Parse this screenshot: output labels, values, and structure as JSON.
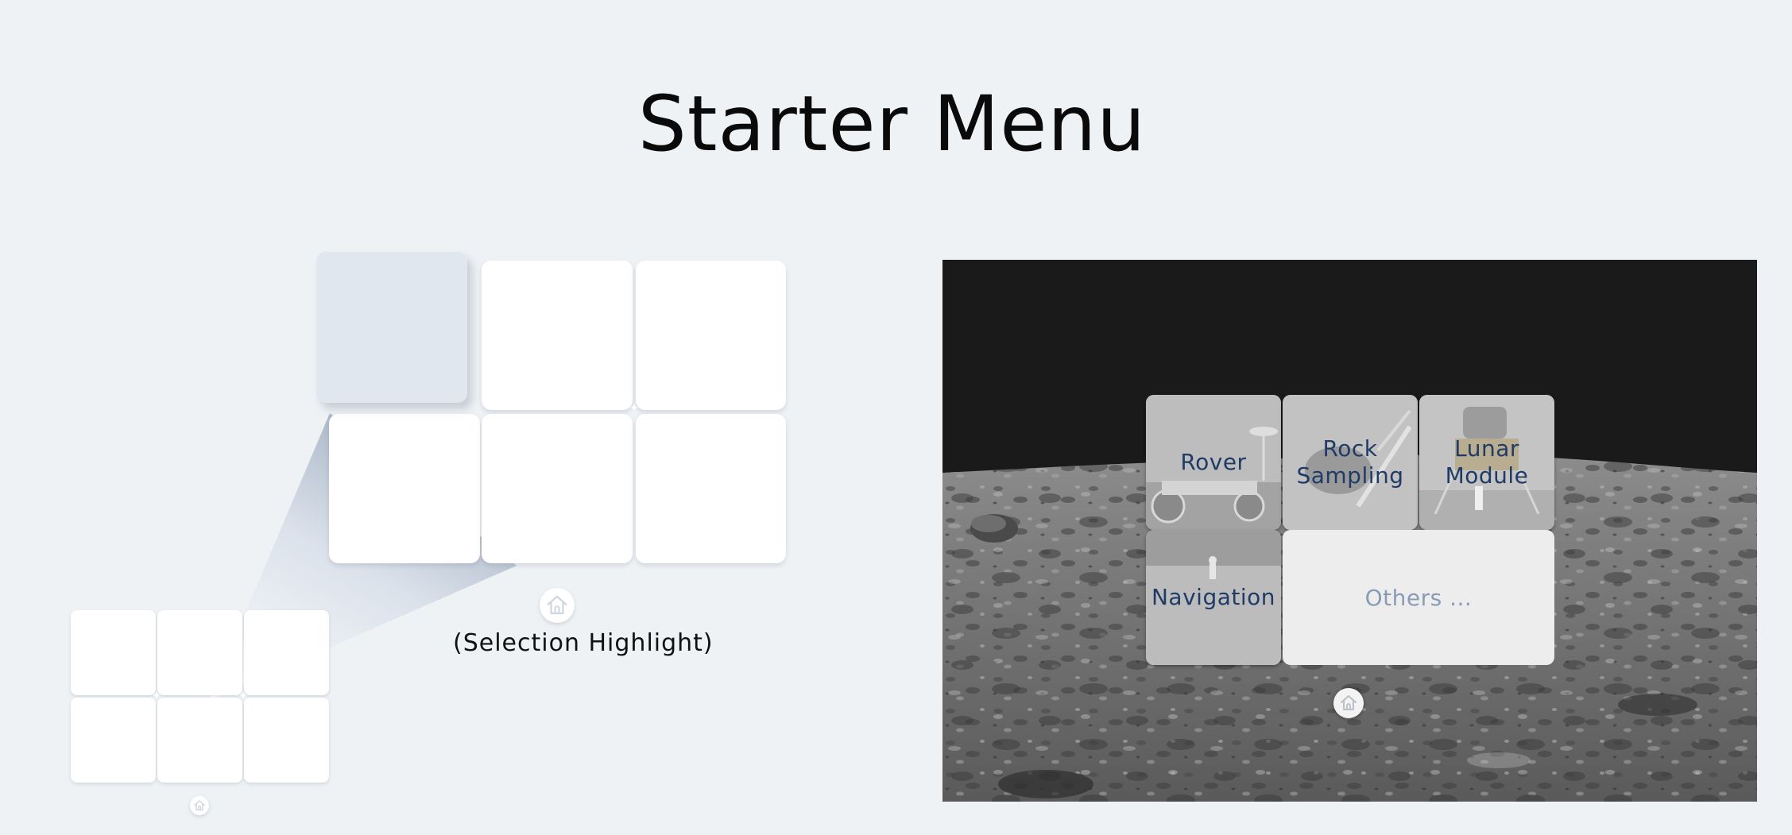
{
  "page": {
    "title": "Starter Menu"
  },
  "diagram": {
    "caption": "(Selection Highlight)",
    "home_icon": "home-icon",
    "colors": {
      "highlight_tile": "#e0e7ef",
      "tile": "#ffffff",
      "background": "#eef2f5"
    }
  },
  "moon_menu": {
    "tiles": [
      {
        "label": "Rover",
        "image": "lunar-rover-photo"
      },
      {
        "label": "Rock\nSampling",
        "image": "rock-sampling-photo"
      },
      {
        "label": "Lunar\nModule",
        "image": "lunar-module-photo"
      },
      {
        "label": "Navigation",
        "image": "navigation-photo"
      }
    ],
    "others_label": "Others ...",
    "home_icon": "home-icon",
    "colors": {
      "label": "#1f3b66",
      "others_label": "#8a9bb4",
      "sky": "#1a1a1a"
    }
  }
}
